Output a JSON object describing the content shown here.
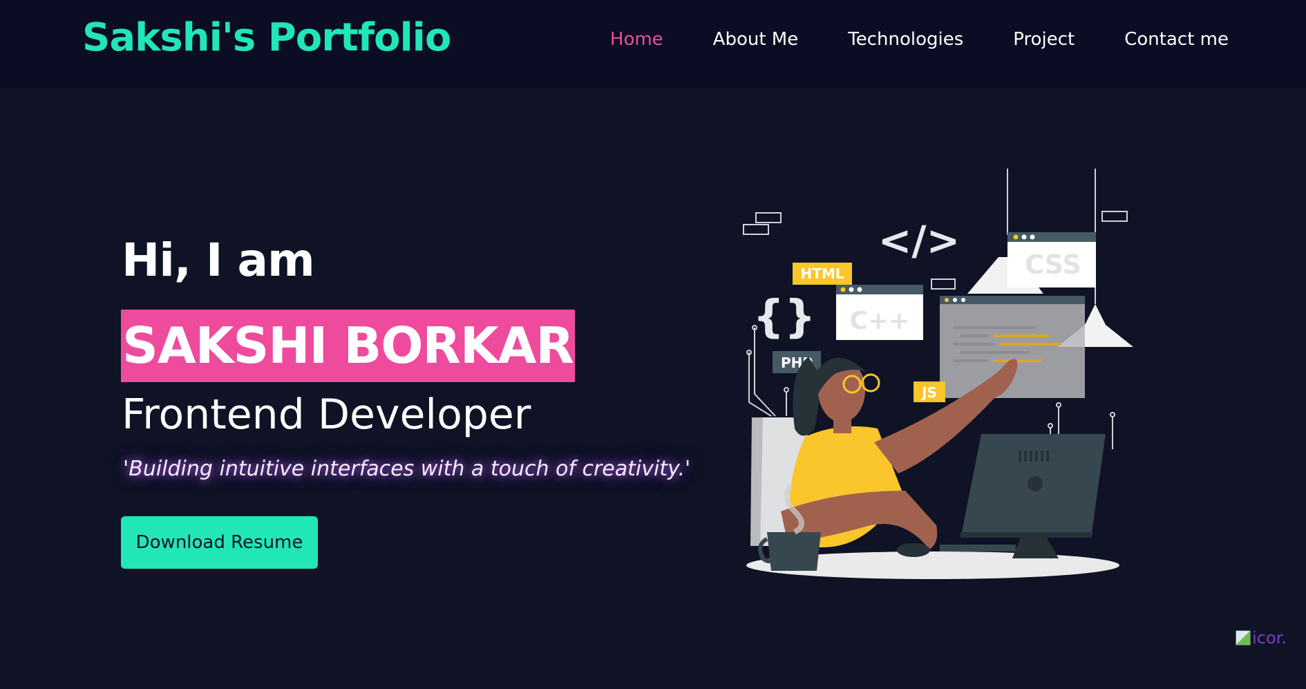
{
  "brand": "Sakshi's Portfolio",
  "nav": {
    "items": [
      {
        "label": "Home",
        "active": true
      },
      {
        "label": "About Me",
        "active": false
      },
      {
        "label": "Technologies",
        "active": false
      },
      {
        "label": "Project",
        "active": false
      },
      {
        "label": "Contact me",
        "active": false
      }
    ]
  },
  "hero": {
    "greeting": "Hi, I am",
    "name": "SAKSHI BORKAR",
    "role": "Frontend Developer",
    "tagline": "'Building intuitive interfaces with a touch of creativity.'",
    "button_label": "Download Resume"
  },
  "illustration": {
    "labels": {
      "html": "HTML",
      "css": "CSS",
      "cpp": "C++",
      "php": "PHP",
      "js": "JS",
      "braces": "{}",
      "code_tag": "</>"
    }
  },
  "badge": {
    "text": "icor."
  },
  "colors": {
    "background": "#0f1325",
    "navbar": "#0a0d23",
    "accent_green": "#21e6b6",
    "accent_pink": "#ef4b9c",
    "tag_yellow": "#fbc52c"
  }
}
